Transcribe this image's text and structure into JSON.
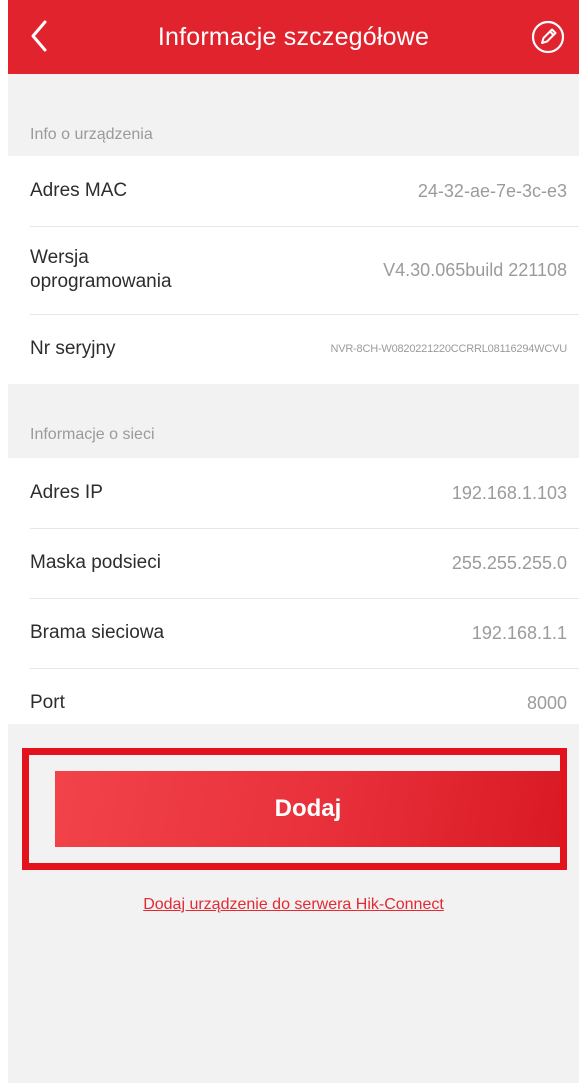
{
  "header": {
    "title": "Informacje szczegółowe",
    "back_icon": "chevron-left-icon",
    "edit_icon": "edit-pencil-icon",
    "background_color": "#e1232e"
  },
  "device_info": {
    "section_label": "Info o urządzenia",
    "rows": [
      {
        "label": "Adres MAC",
        "value": "24-32-ae-7e-3c-e3"
      },
      {
        "label": "Wersja oprogramowania",
        "value": "V4.30.065build 221108"
      },
      {
        "label": "Nr seryjny",
        "value": "NVR-8CH-W0820221220CCRRL08116294WCVU"
      }
    ]
  },
  "network_info": {
    "section_label": "Informacje o sieci",
    "rows": [
      {
        "label": "Adres IP",
        "value": "192.168.1.103"
      },
      {
        "label": "Maska podsieci",
        "value": "255.255.255.0"
      },
      {
        "label": "Brama sieciowa",
        "value": "192.168.1.1"
      },
      {
        "label": "Port",
        "value": "8000"
      }
    ]
  },
  "actions": {
    "add_label": "Dodaj",
    "server_link": "Dodaj urządzenie do serwera Hik-Connect",
    "accent_color": "#e3121c"
  }
}
